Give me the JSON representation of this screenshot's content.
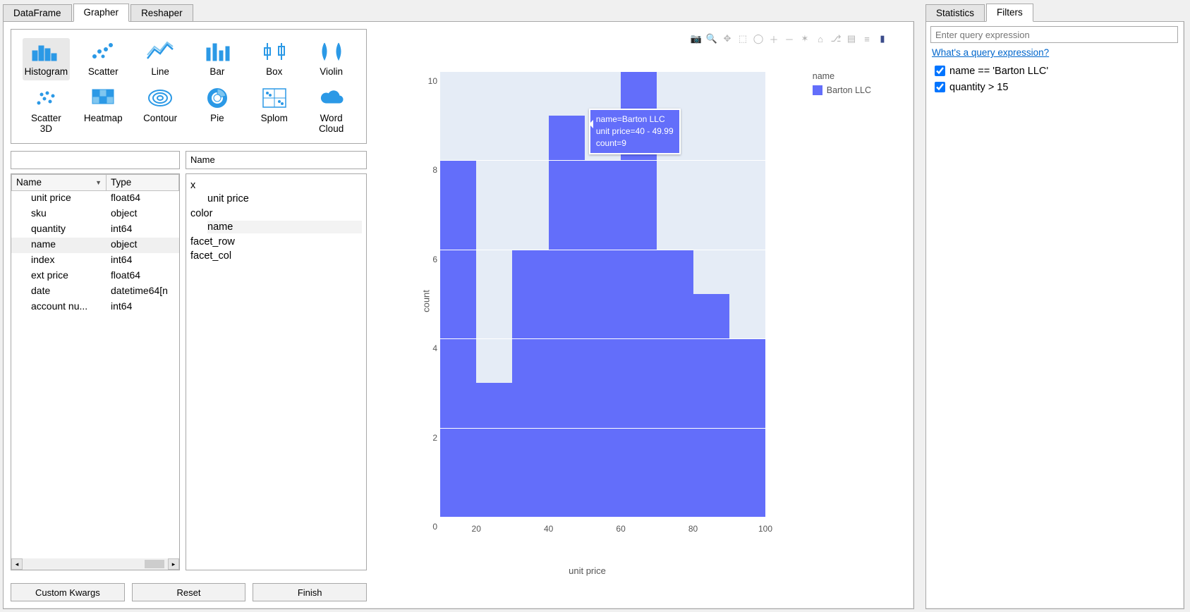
{
  "left_tabs": {
    "items": [
      "DataFrame",
      "Grapher",
      "Reshaper"
    ],
    "active_index": 1
  },
  "right_tabs": {
    "items": [
      "Statistics",
      "Filters"
    ],
    "active_index": 1
  },
  "chart_types": {
    "items": [
      {
        "id": "histogram",
        "label": "Histogram",
        "selected": true
      },
      {
        "id": "scatter",
        "label": "Scatter"
      },
      {
        "id": "line",
        "label": "Line"
      },
      {
        "id": "bar",
        "label": "Bar"
      },
      {
        "id": "box",
        "label": "Box"
      },
      {
        "id": "violin",
        "label": "Violin"
      },
      {
        "id": "scatter3d",
        "label": "Scatter\n3D"
      },
      {
        "id": "heatmap",
        "label": "Heatmap"
      },
      {
        "id": "contour",
        "label": "Contour"
      },
      {
        "id": "pie",
        "label": "Pie"
      },
      {
        "id": "splom",
        "label": "Splom"
      },
      {
        "id": "wordcloud",
        "label": "Word\nCloud"
      }
    ]
  },
  "field_search_value": "",
  "field_table": {
    "headers": {
      "name": "Name",
      "type": "Type"
    },
    "rows": [
      {
        "name": "unit price",
        "type": "float64"
      },
      {
        "name": "sku",
        "type": "object"
      },
      {
        "name": "quantity",
        "type": "int64"
      },
      {
        "name": "name",
        "type": "object",
        "selected": true
      },
      {
        "name": "index",
        "type": "int64"
      },
      {
        "name": "ext price",
        "type": "float64"
      },
      {
        "name": "date",
        "type": "datetime64[n"
      },
      {
        "name": "account nu...",
        "type": "int64"
      }
    ]
  },
  "mapping": {
    "header": "Name",
    "entries": [
      {
        "root": "x",
        "children": [
          "unit price"
        ]
      },
      {
        "root": "color",
        "children": [
          "name"
        ],
        "child_selected": true
      },
      {
        "root": "facet_row",
        "children": []
      },
      {
        "root": "facet_col",
        "children": []
      }
    ]
  },
  "bottom_buttons": {
    "kw": "Custom Kwargs",
    "reset": "Reset",
    "finish": "Finish"
  },
  "filters": {
    "placeholder": "Enter query expression",
    "help_link": "What's a query expression?",
    "items": [
      {
        "label": "name == 'Barton LLC'",
        "checked": true
      },
      {
        "label": "quantity > 15",
        "checked": true
      }
    ]
  },
  "tooltip": {
    "line1": "name=Barton LLC",
    "line2": "unit price=40 - 49.99",
    "line3": "count=9"
  },
  "legend": {
    "title": "name",
    "items": [
      {
        "label": "Barton LLC",
        "color": "#636EFA"
      }
    ]
  },
  "chart_data": {
    "type": "bar",
    "title": "",
    "xlabel": "unit price",
    "ylabel": "count",
    "ylim": [
      0,
      10
    ],
    "yticks": [
      0,
      2,
      4,
      6,
      8,
      10
    ],
    "xticks": [
      20,
      40,
      60,
      80,
      100
    ],
    "series": [
      {
        "name": "Barton LLC",
        "color": "#636EFA",
        "bins": [
          {
            "range": "10 - 19.99",
            "count": 8
          },
          {
            "range": "20 - 29.99",
            "count": 3
          },
          {
            "range": "30 - 39.99",
            "count": 6
          },
          {
            "range": "40 - 49.99",
            "count": 9
          },
          {
            "range": "50 - 59.99",
            "count": 8
          },
          {
            "range": "60 - 69.99",
            "count": 10
          },
          {
            "range": "70 - 79.99",
            "count": 6
          },
          {
            "range": "80 - 89.99",
            "count": 5
          },
          {
            "range": "90 - 99.99",
            "count": 4
          }
        ]
      }
    ]
  },
  "plot_toolbar_icons": [
    {
      "name": "camera-icon",
      "glyph": "📷"
    },
    {
      "name": "zoom-icon",
      "glyph": "🔍"
    },
    {
      "name": "pan-icon",
      "glyph": "✥"
    },
    {
      "name": "box-select-icon",
      "glyph": "⬚"
    },
    {
      "name": "lasso-icon",
      "glyph": "◯"
    },
    {
      "name": "zoom-in-icon",
      "glyph": "＋"
    },
    {
      "name": "zoom-out-icon",
      "glyph": "－"
    },
    {
      "name": "autoscale-icon",
      "glyph": "✶"
    },
    {
      "name": "home-icon",
      "glyph": "⌂"
    },
    {
      "name": "spike-icon",
      "glyph": "⎇"
    },
    {
      "name": "hover-icon",
      "glyph": "▤"
    },
    {
      "name": "compare-icon",
      "glyph": "≡"
    },
    {
      "name": "logo-icon",
      "glyph": "▮",
      "dark": true
    }
  ]
}
